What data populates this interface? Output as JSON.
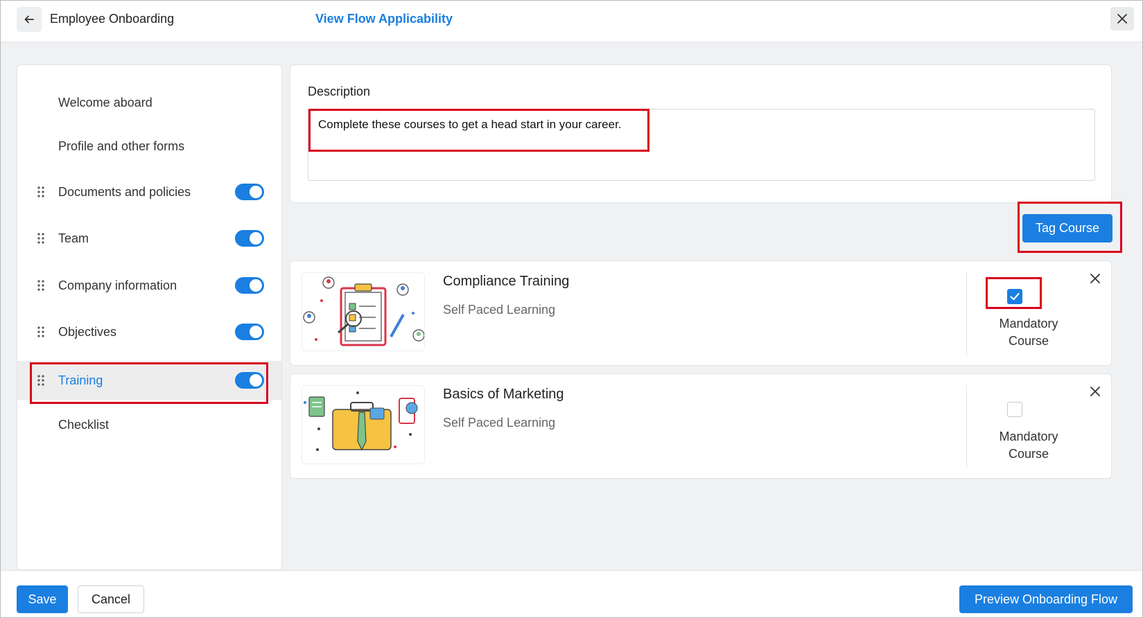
{
  "header": {
    "title": "Employee Onboarding",
    "link": "View Flow Applicability",
    "back_icon": "arrow-left-icon",
    "close_icon": "close-icon"
  },
  "sidebar": {
    "items": [
      {
        "label": "Welcome aboard",
        "draggable": false,
        "toggle": false
      },
      {
        "label": "Profile and other forms",
        "draggable": false,
        "toggle": false
      },
      {
        "label": "Documents and policies",
        "draggable": true,
        "toggle": true
      },
      {
        "label": "Team",
        "draggable": true,
        "toggle": true
      },
      {
        "label": "Company information",
        "draggable": true,
        "toggle": true
      },
      {
        "label": "Objectives",
        "draggable": true,
        "toggle": true
      },
      {
        "label": "Training",
        "draggable": true,
        "toggle": true,
        "active": true
      },
      {
        "label": "Checklist",
        "draggable": false,
        "toggle": false
      }
    ]
  },
  "description": {
    "label": "Description",
    "value": "Complete these courses to get a head start in your career."
  },
  "tag_course_label": "Tag Course",
  "courses": [
    {
      "title": "Compliance Training",
      "subtitle": "Self Paced Learning",
      "mandatory_label_line1": "Mandatory",
      "mandatory_label_line2": "Course",
      "mandatory": true
    },
    {
      "title": "Basics of Marketing",
      "subtitle": "Self Paced Learning",
      "mandatory_label_line1": "Mandatory",
      "mandatory_label_line2": "Course",
      "mandatory": false
    }
  ],
  "footer": {
    "save_label": "Save",
    "cancel_label": "Cancel",
    "preview_label": "Preview Onboarding Flow"
  },
  "colors": {
    "accent": "#1a7fe0",
    "highlight": "#d9001b",
    "background": "#f0f1f3"
  }
}
